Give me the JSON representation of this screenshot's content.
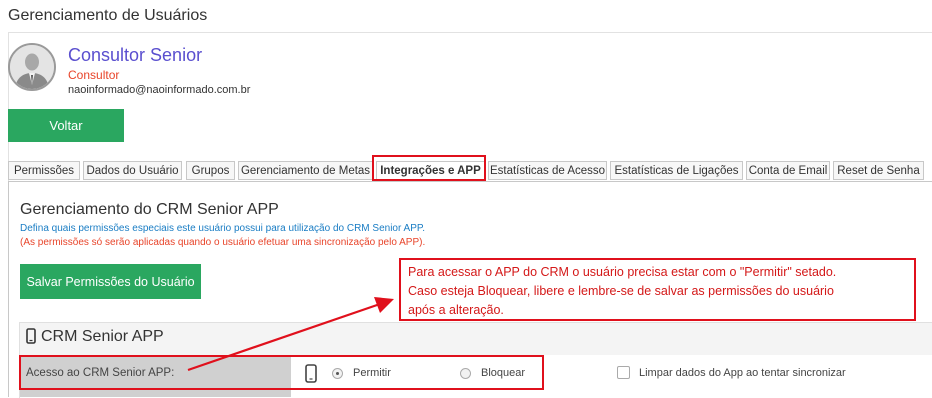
{
  "page": {
    "title": "Gerenciamento de Usuários"
  },
  "user": {
    "name": "Consultor Senior",
    "role": "Consultor",
    "email": "naoinformado@naoinformado.com.br",
    "avatar_icon": "user-avatar-icon"
  },
  "actions": {
    "back_label": "Voltar"
  },
  "tabs": [
    {
      "label": "Permissões"
    },
    {
      "label": "Dados do Usuário"
    },
    {
      "label": "Grupos"
    },
    {
      "label": "Gerenciamento de Metas"
    },
    {
      "label": "Integrações e APP",
      "active": true
    },
    {
      "label": "Estatísticas de Acesso"
    },
    {
      "label": "Estatísticas de Ligações"
    },
    {
      "label": "Conta de Email"
    },
    {
      "label": "Reset de Senha"
    }
  ],
  "section": {
    "title": "Gerenciamento do CRM Senior APP",
    "description": "Defina quais permissões especiais este usuário possui para utilização do CRM Senior APP.",
    "warning": "(As permissões só serão aplicadas quando o usuário efetuar uma sincronização pelo APP).",
    "save_label": "Salvar Permissões do Usuário"
  },
  "annotation": {
    "lines": [
      "Para acessar o APP do CRM o usuário precisa estar com o \"Permitir\" setado.",
      "Caso esteja Bloquear, libere e lembre-se de salvar as permissões do usuário",
      "após a alteração."
    ]
  },
  "card": {
    "title": "CRM Senior APP",
    "icon": "mobile-phone-icon",
    "access_label": "Acesso ao CRM Senior APP:",
    "options": [
      {
        "label": "Permitir",
        "selected": true
      },
      {
        "label": "Bloquear",
        "selected": false
      }
    ],
    "clear_label": "Limpar dados do App ao tentar sincronizar",
    "clear_checked": false
  },
  "colors": {
    "primary_green": "#2aa760",
    "highlight_red": "#e0101c",
    "name_purple": "#5a4fcf",
    "role_red": "#e8442a",
    "info_blue": "#1a7dc4"
  }
}
